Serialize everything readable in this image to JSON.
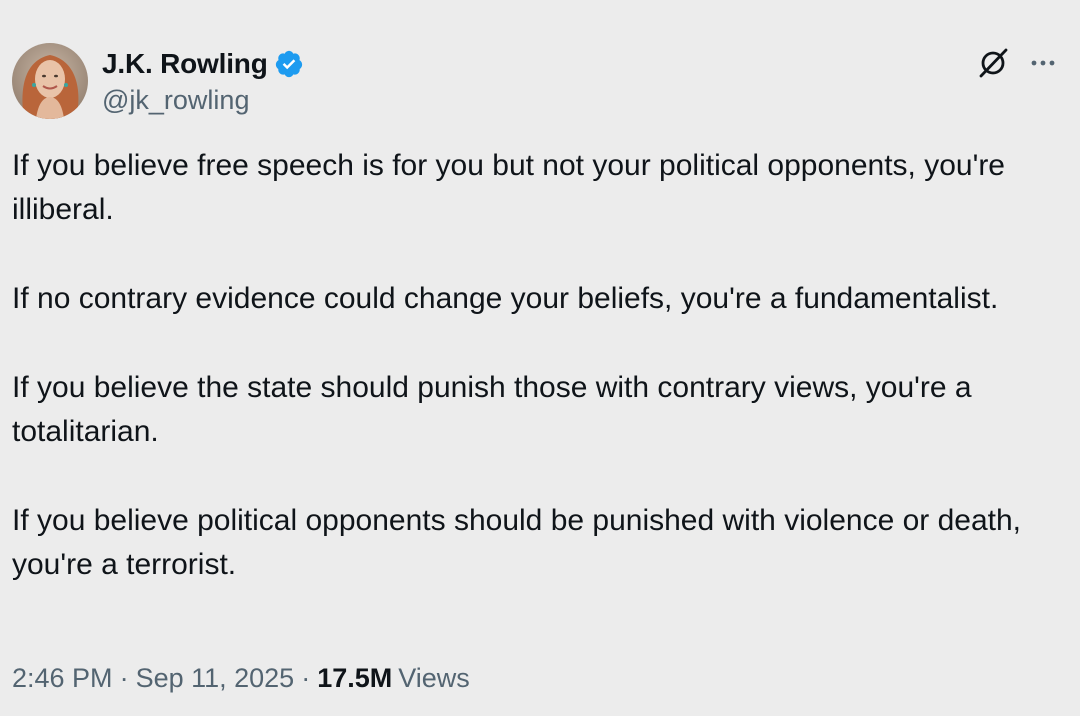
{
  "author": {
    "display_name": "J.K. Rowling",
    "handle": "@jk_rowling",
    "verified": true,
    "verified_color": "#1d9bf0"
  },
  "actions": {
    "grok_icon": "grok-icon",
    "more_icon": "more-horizontal-icon"
  },
  "tweet": {
    "paragraphs": [
      "If you believe free speech is for you but not your political opponents, you're illiberal.",
      "If no contrary evidence could change your beliefs, you're a fundamentalist.",
      "If you believe the state should punish those with contrary views, you're a totalitarian.",
      "If you believe political opponents should be punished with violence or death, you're a terrorist."
    ]
  },
  "meta": {
    "time": "2:46 PM",
    "separator": "·",
    "date": "Sep 11, 2025",
    "views_count": "17.5M",
    "views_label": "Views"
  },
  "colors": {
    "background": "#ececec",
    "text_primary": "#0f1419",
    "text_secondary": "#536471"
  }
}
